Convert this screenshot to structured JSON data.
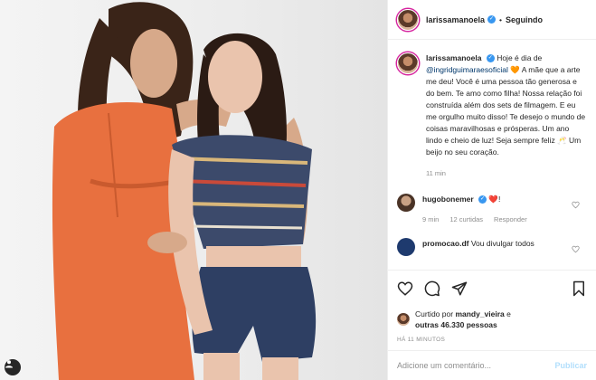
{
  "post": {
    "author": "larissamanoela",
    "follow_state": "Seguindo",
    "separator": "•",
    "verified_icon": "verified-badge-icon"
  },
  "caption": {
    "username": "larissamanoela",
    "text_1": "Hoje é dia de",
    "mention": "@ingridguimaraesoficial",
    "text_2": "🧡 A mãe que a arte me deu! Você é uma pessoa tão generosa e do bem. Te amo como filha! Nossa relação foi construída além dos sets de filmagem. E eu me orgulho muito disso! Te desejo o mundo de coisas maravilhosas e prósperas. Um ano lindo e cheio de luz! Seja sempre feliz 🥂 Um beijo no seu coração.",
    "time": "11 min"
  },
  "comments": [
    {
      "username": "hugobonemer",
      "text": "❤️!",
      "time": "9 min",
      "likes": "12 curtidas",
      "reply": "Responder"
    },
    {
      "username": "promocao.df",
      "text": "Vou divulgar todos"
    }
  ],
  "likes": {
    "prefix": "Curtido por",
    "user": "mandy_vieira",
    "connector": "e",
    "others": "outras 46.330 pessoas"
  },
  "timestamp": "HÁ 11 MINUTOS",
  "add_comment": {
    "placeholder": "Adicione um comentário...",
    "publish": "Publicar"
  },
  "colors": {
    "accent_blue": "#3897f0",
    "publish_disabled": "#b2dffc",
    "dress_orange": "#e8703f",
    "shorts_navy": "#2e3f63"
  }
}
